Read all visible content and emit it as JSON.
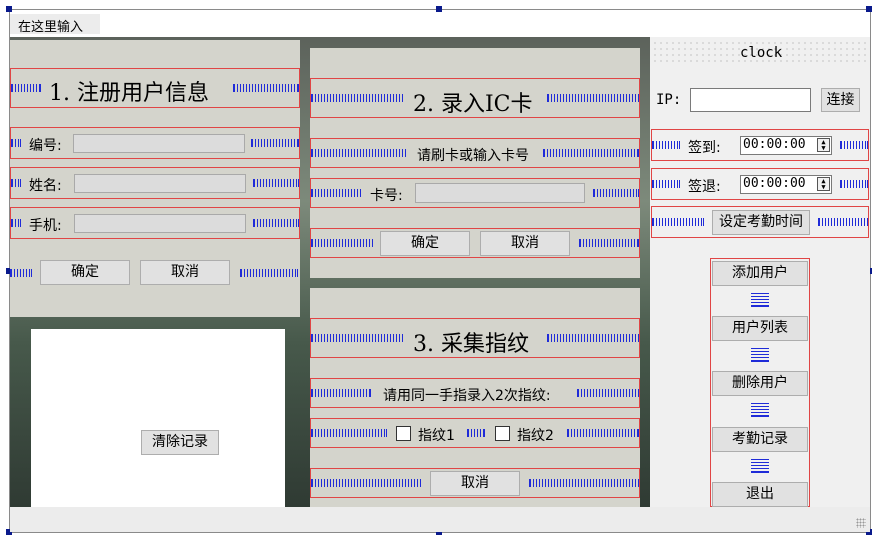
{
  "menu": {
    "placeholder_item": "在这里输入"
  },
  "register": {
    "title": "1. 注册用户信息",
    "id_label": "编号:",
    "name_label": "姓名:",
    "phone_label": "手机:",
    "confirm": "确定",
    "cancel": "取消"
  },
  "ic_card": {
    "title": "2. 录入IC卡",
    "prompt": "请刷卡或输入卡号",
    "card_label": "卡号:",
    "confirm": "确定",
    "cancel": "取消"
  },
  "fingerprint": {
    "title": "3. 采集指纹",
    "prompt": "请用同一手指录入2次指纹:",
    "fp1": "指纹1",
    "fp2": "指纹2",
    "cancel": "取消"
  },
  "log": {
    "clear_button": "清除记录"
  },
  "right": {
    "clock": "clock",
    "ip_label": "IP:",
    "connect": "连接",
    "signin_label": "签到:",
    "signin_time": "00:00:00",
    "signout_label": "签退:",
    "signout_time": "00:00:00",
    "set_time": "设定考勤时间",
    "actions": [
      "添加用户",
      "用户列表",
      "删除用户",
      "考勤记录",
      "退出"
    ]
  }
}
